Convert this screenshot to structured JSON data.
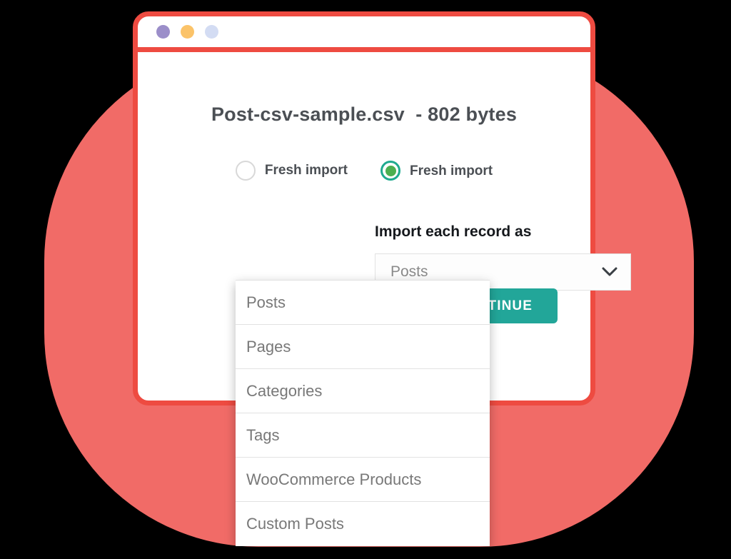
{
  "window": {
    "traffic_lights": [
      {
        "name": "close-dot",
        "color": "#9b8ec9"
      },
      {
        "name": "minimize-dot",
        "color": "#fbc369"
      },
      {
        "name": "maximize-dot",
        "color": "#d3dcf3"
      }
    ],
    "border_color": "#ee4b41"
  },
  "background": {
    "blob_color": "#f16b67"
  },
  "content": {
    "file_title": "Post-csv-sample.csv  - 802 bytes",
    "radios": [
      {
        "label": "Fresh import",
        "selected": false
      },
      {
        "label": "Fresh import",
        "selected": true
      }
    ],
    "section_label": "Import each record as",
    "select": {
      "value": "Posts",
      "icon": "chevron-down-icon"
    },
    "continue_label": "CONTINUE",
    "dropdown_options": [
      "Posts",
      "Pages",
      "Categories",
      "Tags",
      "WooCommerce Products",
      "Custom Posts"
    ]
  },
  "colors": {
    "accent_teal": "#22a699",
    "radio_ring": "#1faa8f",
    "radio_dot": "#4caf50",
    "red": "#ee4b41"
  }
}
